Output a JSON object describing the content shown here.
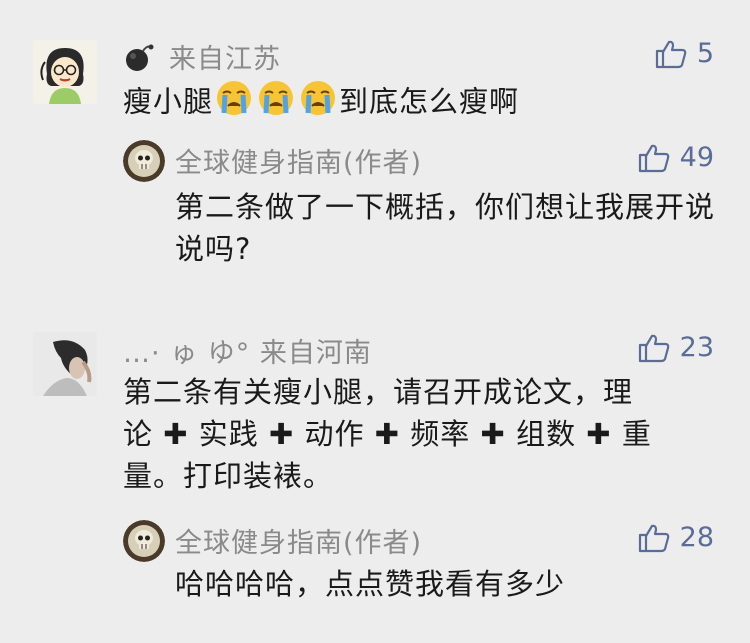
{
  "comments": [
    {
      "name": "来自江苏",
      "likes": "5",
      "text_before": "瘦小腿",
      "emoji": [
        "crying-face",
        "crying-face",
        "crying-face"
      ],
      "text_after": "到底怎么瘦啊",
      "reply": {
        "name": "全球健身指南(作者)",
        "likes": "49",
        "text": "第二条做了一下概括，你们想让我展开说说吗?"
      }
    },
    {
      "name": "…· ゅ ゆ° 来自河南",
      "likes": "23",
      "text_line1": "第二条有关瘦小腿，请召开成论文，理",
      "text_line2_parts": [
        "论",
        "实践",
        "动作",
        "频率",
        "组数",
        "重"
      ],
      "plus_symbol": "✚",
      "text_line3": "量。打印装裱。",
      "reply": {
        "name": "全球健身指南(作者)",
        "likes": "28",
        "text": "哈哈哈哈，点点赞我看有多少"
      }
    }
  ],
  "icons": {
    "like": "thumbs-up-icon",
    "bomb": "bomb-icon",
    "author_avatar": "skull-avatar"
  },
  "colors": {
    "background": "#ededed",
    "name_gray": "#8a8a8a",
    "like_blue": "#5a6d97"
  }
}
